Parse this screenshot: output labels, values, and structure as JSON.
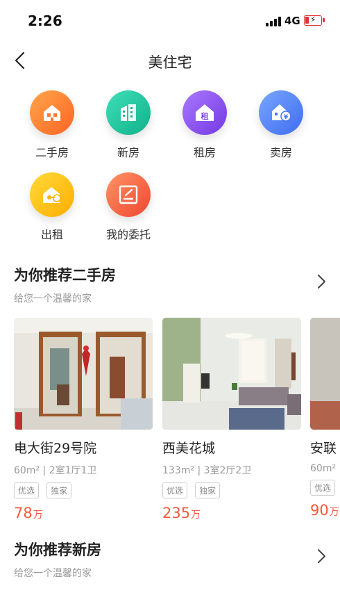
{
  "status_bar": {
    "time": "2:26",
    "network": "4G"
  },
  "nav": {
    "title": "美住宅"
  },
  "services": [
    {
      "label": "二手房",
      "icon": "house-icon",
      "color_from": "#ff9a3d",
      "color_to": "#ff6a2a"
    },
    {
      "label": "新房",
      "icon": "building-icon",
      "color_from": "#35d8b0",
      "color_to": "#14b892"
    },
    {
      "label": "租房",
      "icon": "rent-icon",
      "color_from": "#a06bf5",
      "color_to": "#7a3fe6"
    },
    {
      "label": "卖房",
      "icon": "sell-icon",
      "color_from": "#6d9cfb",
      "color_to": "#4474f0"
    },
    {
      "label": "出租",
      "icon": "key-house-icon",
      "color_from": "#ffd42a",
      "color_to": "#ffb200"
    },
    {
      "label": "我的委托",
      "icon": "edit-icon",
      "color_from": "#ff8a5c",
      "color_to": "#f2503a"
    }
  ],
  "second_hand_section": {
    "title": "为你推荐二手房",
    "subtitle": "给您一个温馨的家",
    "listings": [
      {
        "name": "电大街29号院",
        "area": "60m²",
        "layout": "2室1厅1卫",
        "tags": [
          "优选",
          "独家"
        ],
        "price": "78",
        "unit": "万"
      },
      {
        "name": "西美花城",
        "area": "133m²",
        "layout": "3室2厅2卫",
        "tags": [
          "优选",
          "独家"
        ],
        "price": "235",
        "unit": "万"
      },
      {
        "name": "安联",
        "area": "60m²",
        "layout": "",
        "tags": [
          "优选"
        ],
        "price": "90",
        "unit": "万"
      }
    ]
  },
  "new_house_section": {
    "title": "为你推荐新房",
    "subtitle": "给您一个温馨的家"
  },
  "colors": {
    "price": "#f05a3c",
    "subtitle": "#999999"
  }
}
